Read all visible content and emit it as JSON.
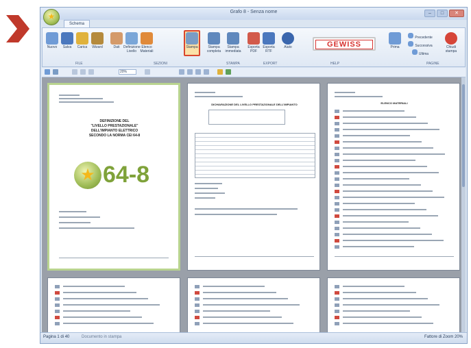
{
  "window": {
    "title": "Grafo 8 - Senza nome"
  },
  "tab": "Schema",
  "ribbon": {
    "buttons": [
      {
        "label": "Nuovo",
        "icon": "new-file-icon",
        "color": "#6f9bd6"
      },
      {
        "label": "Salva",
        "icon": "save-icon",
        "color": "#4b78be"
      },
      {
        "label": "Carica",
        "icon": "open-folder-icon",
        "color": "#e0b23c"
      },
      {
        "label": "Wizard",
        "icon": "wizard-icon",
        "color": "#b58a3c"
      },
      {
        "label": "Dati",
        "icon": "user-data-icon",
        "color": "#d49a6a"
      },
      {
        "label": "Definizione Livello",
        "icon": "level-icon",
        "color": "#7aa6d8"
      },
      {
        "label": "Elenco Materiali",
        "icon": "home-icon",
        "color": "#e08a3a"
      },
      {
        "label": "Stampa",
        "icon": "print-icon",
        "color": "#7a9cc5"
      },
      {
        "label": "Stampa completa",
        "icon": "print-full-icon",
        "color": "#5f88bd"
      },
      {
        "label": "Stampa immediata",
        "icon": "print-now-icon",
        "color": "#5f88bd"
      },
      {
        "label": "Esporta PDF",
        "icon": "export-pdf-icon",
        "color": "#d25a4b"
      },
      {
        "label": "Esporta RTF",
        "icon": "export-rtf-icon",
        "color": "#4b78be"
      },
      {
        "label": "Aiuto",
        "icon": "help-icon",
        "color": "#3a66ad"
      },
      {
        "label": "Prima",
        "icon": "first-page-icon",
        "color": "#6f9bd6"
      },
      {
        "label": "Precedente",
        "icon": "previous-icon",
        "color": "#6f9bd6"
      },
      {
        "label": "Successiva",
        "icon": "next-icon",
        "color": "#6f9bd6"
      },
      {
        "label": "Ultima",
        "icon": "last-page-icon",
        "color": "#6f9bd6"
      },
      {
        "label": "Chiudi stampa",
        "icon": "close-print-icon",
        "color": "#d64538"
      }
    ],
    "groups": [
      "FILE",
      "SEZIONI",
      "STAMPA",
      "EXPORT",
      "HELP",
      "PAGINE"
    ],
    "logo": "GEWISS"
  },
  "toolbar": {
    "zoom": "20%"
  },
  "document": {
    "cover_title": "DEFINIZIONE DEL\n\"LIVELLO PRESTAZIONALE\"\nDELL'IMPIANTO ELETTRICO\nSECONDO LA NORMA CEI 64-8",
    "cover_logo": "64-8",
    "page2_title": "DICHIARAZIONE DEL LIVELLO PRESTAZIONALE DELL'IMPIANTO",
    "page3_title": "ELENCO MATERIALI"
  },
  "status": {
    "left": "Pagina 1 di 40",
    "mid": "Documento in stampa",
    "right": "Fattore di Zoom 20%"
  },
  "accent": "#d9452d"
}
